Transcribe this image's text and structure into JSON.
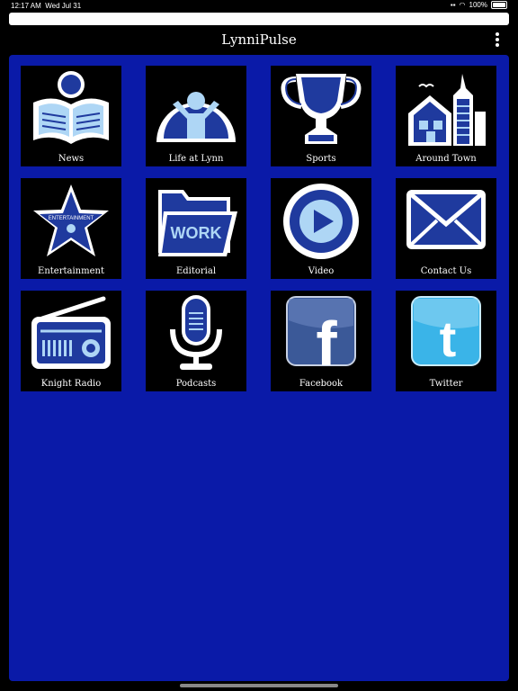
{
  "status": {
    "time": "12:17 AM",
    "date": "Wed Jul 31",
    "battery": "100%"
  },
  "app": {
    "title": "LynniPulse"
  },
  "tiles": [
    {
      "label": "News",
      "icon": "newspaper-reader-icon"
    },
    {
      "label": "Life at Lynn",
      "icon": "person-arms-up-icon"
    },
    {
      "label": "Sports",
      "icon": "trophy-icon"
    },
    {
      "label": "Around Town",
      "icon": "city-buildings-icon"
    },
    {
      "label": "Entertainment",
      "icon": "star-icon",
      "icon_text": "ENTERTAINMENT"
    },
    {
      "label": "Editorial",
      "icon": "folder-icon",
      "icon_text": "WORK"
    },
    {
      "label": "Video",
      "icon": "play-icon"
    },
    {
      "label": "Contact Us",
      "icon": "envelope-icon"
    },
    {
      "label": "Knight Radio",
      "icon": "radio-icon"
    },
    {
      "label": "Podcasts",
      "icon": "microphone-icon"
    },
    {
      "label": "Facebook",
      "icon": "facebook-icon",
      "icon_text": "f"
    },
    {
      "label": "Twitter",
      "icon": "twitter-icon",
      "icon_text": "t"
    }
  ],
  "colors": {
    "panel": "#0a1aa8",
    "icon_fill": "#1f3a9e",
    "icon_light": "#aed6f5",
    "facebook": "#3b5998",
    "twitter": "#3ab4e8"
  }
}
